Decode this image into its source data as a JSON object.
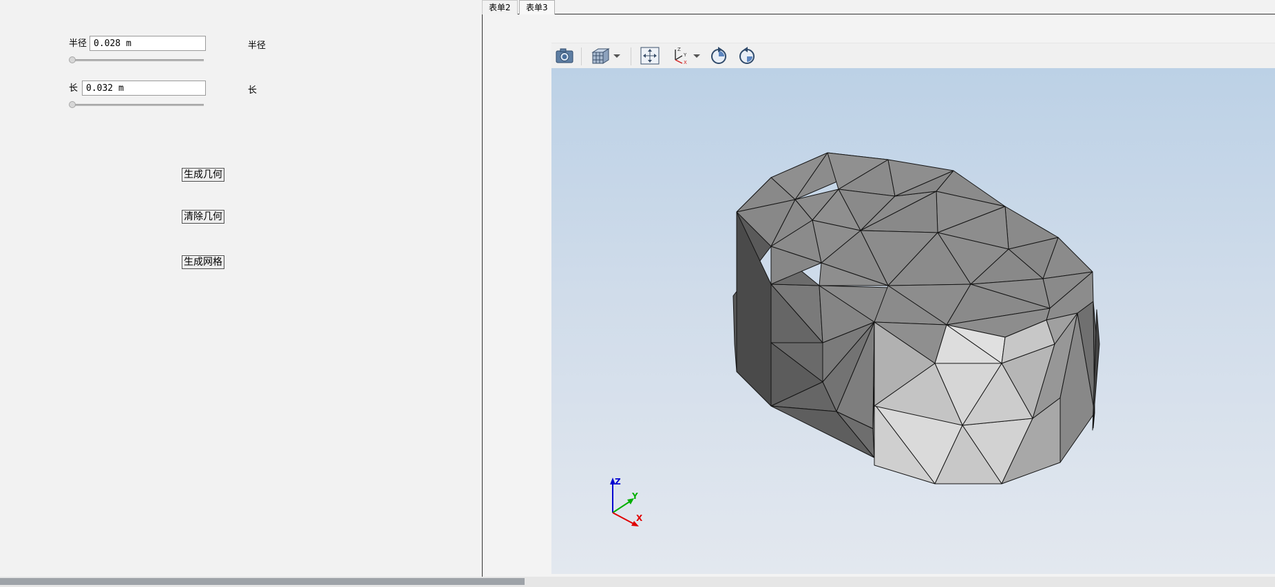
{
  "form": {
    "radius": {
      "label": "半径",
      "value": "0.028 m",
      "side_label": "半径",
      "slider_fraction": 0.0
    },
    "length": {
      "label": "长",
      "value": "0.032 m",
      "side_label": "长",
      "slider_fraction": 0.0
    },
    "buttons": {
      "generate_geometry": "生成几何",
      "clear_geometry": "清除几何",
      "generate_mesh": "生成网格"
    }
  },
  "tabs": [
    {
      "label": "表单2",
      "active": false
    },
    {
      "label": "表单3",
      "active": true
    }
  ],
  "toolbar": {
    "items": [
      "camera-icon",
      "view-cube-icon",
      "dropdown-arrow-icon",
      "fit-view-icon",
      "axes-orientation-icon",
      "dropdown-arrow-icon",
      "rotate-clockwise-icon",
      "rotate-counterclockwise-icon"
    ]
  },
  "axes_triad": {
    "z": "Z",
    "y": "Y",
    "x": "X"
  },
  "colors": {
    "viewport_top": "#bcd1e6",
    "viewport_bottom": "#e3e8ef",
    "axis_x": "#e00000",
    "axis_y": "#00b000",
    "axis_z": "#0000d0"
  }
}
